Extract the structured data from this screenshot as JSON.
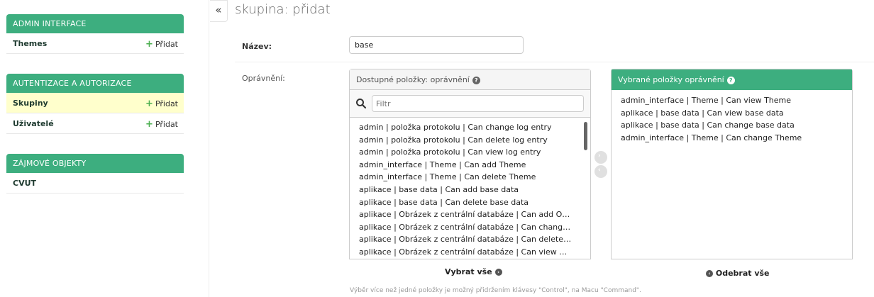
{
  "sidebar": {
    "modules": [
      {
        "title": "ADMIN INTERFACE",
        "items": [
          {
            "label": "Themes",
            "add": "Přidat"
          }
        ]
      },
      {
        "title": "AUTENTIZACE A AUTORIZACE",
        "items": [
          {
            "label": "Skupiny",
            "add": "Přidat",
            "current": true
          },
          {
            "label": "Uživatelé",
            "add": "Přidat"
          }
        ]
      },
      {
        "title": "ZÁJMOVÉ OBJEKTY",
        "items": [
          {
            "label": "CVUT"
          }
        ]
      }
    ]
  },
  "collapse_label": "«",
  "page_title": "skupina: přidat",
  "form": {
    "name_label": "Název:",
    "name_value": "base",
    "permissions_label": "Oprávnění:"
  },
  "selector": {
    "available_title": "Dostupné položky: oprávnění",
    "filter_placeholder": "Filtr",
    "available_items": [
      "admin | položka protokolu | Can change log entry",
      "admin | položka protokolu | Can delete log entry",
      "admin | položka protokolu | Can view log entry",
      "admin_interface | Theme | Can add Theme",
      "admin_interface | Theme | Can delete Theme",
      "aplikace | base data | Can add base data",
      "aplikace | base data | Can delete base data",
      "aplikace | Obrázek z centrální databáze | Can add Obrázek z centrální databáze",
      "aplikace | Obrázek z centrální databáze | Can change Obrázek z centrální databáze",
      "aplikace | Obrázek z centrální databáze | Can delete Obrázek z centrální databáze",
      "aplikace | Obrázek z centrální databáze | Can view Obrázek z centrální databáze"
    ],
    "chosen_title": "Vybrané položky oprávnění",
    "chosen_items": [
      "admin_interface | Theme | Can view Theme",
      "aplikace | base data | Can view base data",
      "aplikace | base data | Can change base data",
      "admin_interface | Theme | Can change Theme"
    ],
    "choose_all": "Vybrat vše",
    "clear_all": "Odebrat vše",
    "help_text": "Výběr více než jedné položky je možný přidržením klávesy \"Control\", na Macu \"Command\"."
  },
  "colors": {
    "accent": "#3dae7f",
    "current_row": "#ffffcc"
  },
  "icons": [
    "plus-icon",
    "search-icon",
    "help-icon",
    "arrow-right-icon",
    "arrow-left-icon"
  ]
}
